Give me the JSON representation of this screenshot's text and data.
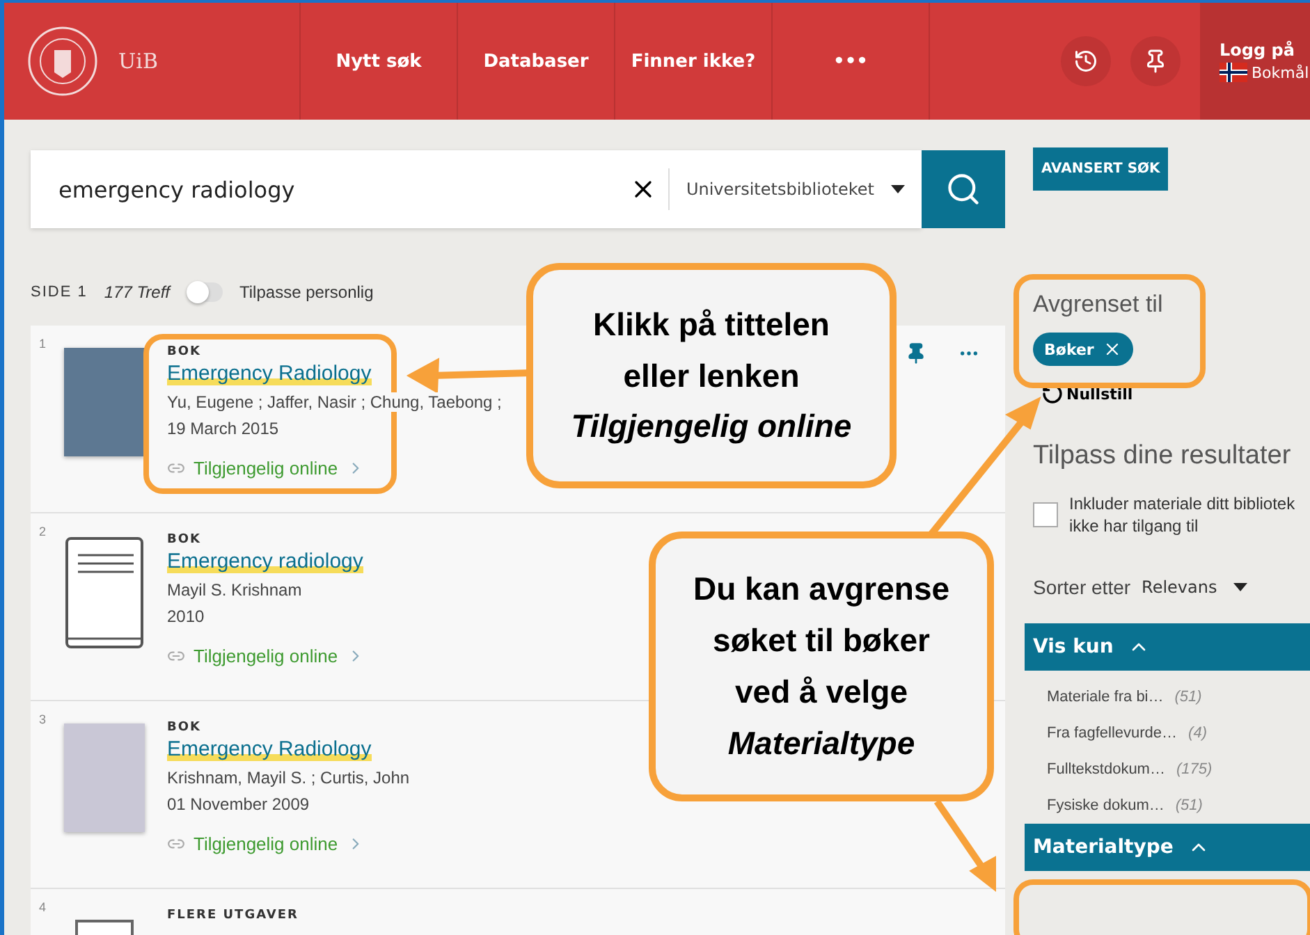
{
  "header": {
    "logo_text": "UiB",
    "nav": [
      "Nytt søk",
      "Databaser",
      "Finner ikke?",
      "•••"
    ],
    "login": "Logg på",
    "language": "Bokmål"
  },
  "search": {
    "value": "emergency radiology",
    "scope": "Universitetsbiblioteket",
    "advanced": "AVANSERT SØK"
  },
  "results_bar": {
    "page": "SIDE 1",
    "count": "177 Treff",
    "toggle_label": "Tilpasse personlig",
    "toggle_on": false
  },
  "results": [
    {
      "number": "1",
      "kind": "cover-photo",
      "type": "BOK",
      "title": "Emergency Radiology",
      "authors": "Yu, Eugene ; Jaffer, Nasir ; Chung, Taebong ;",
      "date": "19 March 2015",
      "link": "Tilgjengelig online",
      "pinned": true
    },
    {
      "number": "2",
      "kind": "book-icon",
      "type": "BOK",
      "title": "Emergency radiology",
      "authors": "Mayil S. Krishnam",
      "date": "2010",
      "link": "Tilgjengelig online",
      "pinned": false
    },
    {
      "number": "3",
      "kind": "cover-photo",
      "type": "BOK",
      "title": "Emergency Radiology",
      "authors": "Krishnam, Mayil S. ; Curtis, John",
      "date": "01 November 2009",
      "link": "Tilgjengelig online",
      "pinned": false
    },
    {
      "number": "4",
      "kind": "multi-icon",
      "type": "FLERE UTGAVER",
      "pinned": false
    }
  ],
  "sidebar": {
    "active_title": "Avgrenset til",
    "chip": "Bøker",
    "reset": "Nullstill",
    "tailor_title": "Tilpass dine resultater",
    "include_label": "Inkluder materiale ditt bibliotek ikke har tilgang til",
    "include_checked": false,
    "sort_label": "Sorter etter",
    "sort_value": "Relevans",
    "facets": [
      {
        "title": "Vis kun",
        "expanded": true,
        "items": [
          {
            "label": "Materiale fra bi…",
            "count": "(51)"
          },
          {
            "label": "Fra fagfellevurde…",
            "count": "(4)"
          },
          {
            "label": "Fulltekstdokum…",
            "count": "(175)"
          },
          {
            "label": "Fysiske dokum…",
            "count": "(51)"
          }
        ]
      },
      {
        "title": "Materialtype",
        "expanded": true
      }
    ]
  },
  "callouts": [
    {
      "lines": [
        "Klikk på tittelen",
        "eller lenken",
        "*Tilgjengelig online*"
      ]
    },
    {
      "lines": [
        "Du kan avgrense",
        "søket til bøker",
        "ved å velge",
        "*Materialtype*"
      ]
    }
  ]
}
